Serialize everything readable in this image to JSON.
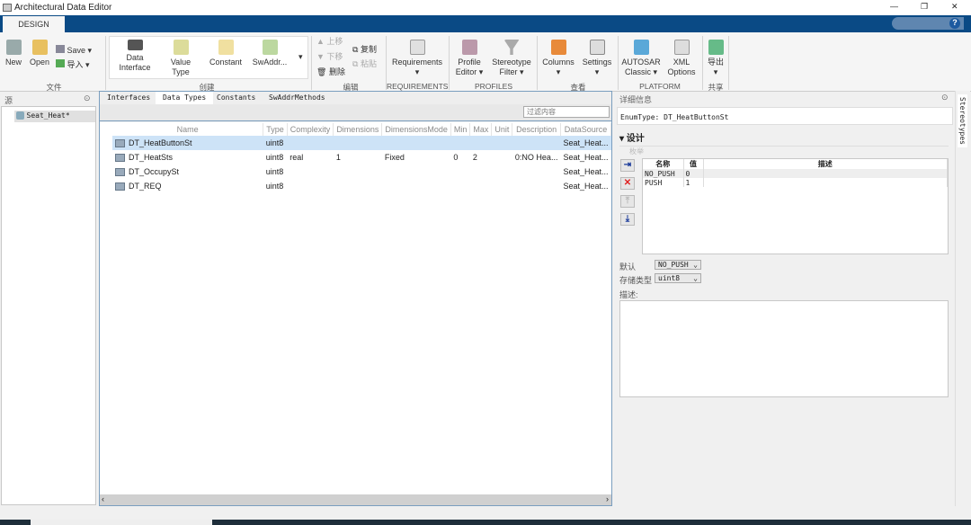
{
  "window": {
    "title": "Architectural Data Editor",
    "minimize": "—",
    "restore": "❐",
    "close": "✕"
  },
  "tabs": {
    "design": "DESIGN",
    "help": "?"
  },
  "ribbon": {
    "file": {
      "new": "New",
      "open": "Open",
      "save": "Save",
      "import": "导入",
      "group": "文件"
    },
    "create": {
      "data_interface": [
        "Data",
        "Interface"
      ],
      "value_type": [
        "Value",
        "Type"
      ],
      "constant": "Constant",
      "swaddr": "SwAddr...",
      "group": "创建"
    },
    "edit": {
      "up": "上移",
      "down": "下移",
      "delete": "删除",
      "copy": "复制",
      "paste": "粘贴",
      "group": "编辑"
    },
    "requirements": {
      "label": "Requirements",
      "group": "REQUIREMENTS"
    },
    "profiles": {
      "profile_editor": [
        "Profile",
        "Editor ▾"
      ],
      "stereotype_filter": [
        "Stereotype",
        "Filter ▾"
      ],
      "group": "PROFILES"
    },
    "view": {
      "columns": "Columns",
      "settings": "Settings",
      "group": "查看"
    },
    "platform": {
      "autosar": [
        "AUTOSAR",
        "Classic ▾"
      ],
      "xml": [
        "XML",
        "Options"
      ],
      "group": "PLATFORM"
    },
    "share": {
      "export": "导出",
      "group": "共享"
    }
  },
  "left": {
    "header": "源",
    "tree_item": "Seat_Heat*"
  },
  "center": {
    "tabs": [
      "Interfaces",
      "Data Types",
      "Constants",
      "SwAddrMethods"
    ],
    "active_tab": 1,
    "filter_placeholder": "过滤内容",
    "columns": [
      "Name",
      "Type",
      "Complexity",
      "Dimensions",
      "DimensionsMode",
      "Min",
      "Max",
      "Unit",
      "Description",
      "DataSource"
    ],
    "rows": [
      [
        "DT_HeatButtonSt",
        "uint8",
        "",
        "",
        "",
        "",
        "",
        "",
        "",
        "Seat_Heat..."
      ],
      [
        "DT_HeatSts",
        "uint8",
        "real",
        "1",
        "Fixed",
        "0",
        "2",
        "",
        "0:NO Hea...",
        "Seat_Heat..."
      ],
      [
        "DT_OccupySt",
        "uint8",
        "",
        "",
        "",
        "",
        "",
        "",
        "",
        "Seat_Heat..."
      ],
      [
        "DT_REQ",
        "uint8",
        "",
        "",
        "",
        "",
        "",
        "",
        "",
        "Seat_Heat..."
      ]
    ],
    "selected_row": 0
  },
  "right": {
    "header": "详细信息",
    "type_line": "EnumType: DT_HeatButtonSt",
    "section": "▾ 设计",
    "subsection": "枚举",
    "enum_columns": [
      "名称",
      "值",
      "描述"
    ],
    "enum_rows": [
      [
        "NO_PUSH",
        "0",
        ""
      ],
      [
        "PUSH",
        "1",
        ""
      ]
    ],
    "default_label": "默认",
    "default_value": "NO_PUSH",
    "storage_label": "存储类型",
    "storage_value": "uint8",
    "desc_label": "描述:",
    "side_tab": "Stereotypes"
  },
  "colors": {
    "accent": "#0a4a85",
    "selection": "#cde3f7"
  }
}
